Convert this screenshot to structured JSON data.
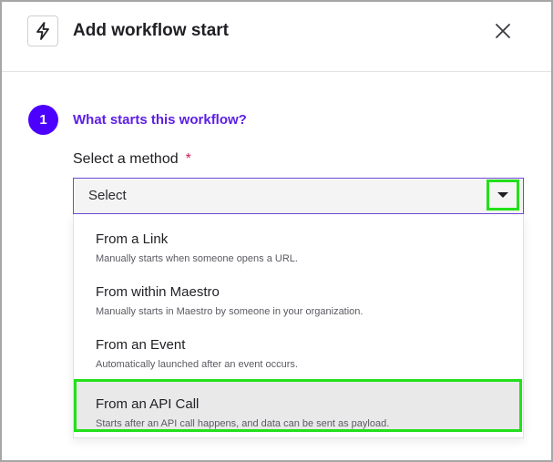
{
  "dialog": {
    "title": "Add workflow start",
    "icon": "bolt-icon",
    "close_icon": "close-icon"
  },
  "step": {
    "number": "1",
    "title": "What starts this workflow?"
  },
  "field": {
    "label": "Select a method",
    "required_mark": "*",
    "value": "Select"
  },
  "options": [
    {
      "title": "From a Link",
      "description": "Manually starts when someone opens a URL."
    },
    {
      "title": "From within Maestro",
      "description": "Manually starts in Maestro by someone in your organization."
    },
    {
      "title": "From an Event",
      "description": "Automatically launched after an event occurs."
    },
    {
      "title": "From an API Call",
      "description": "Starts after an API call happens, and data can be sent as payload."
    }
  ],
  "colors": {
    "accent": "#4c00ff",
    "step_title": "#5d1fe6",
    "required": "#cc1f5a",
    "highlight_outline": "#22e01a"
  }
}
